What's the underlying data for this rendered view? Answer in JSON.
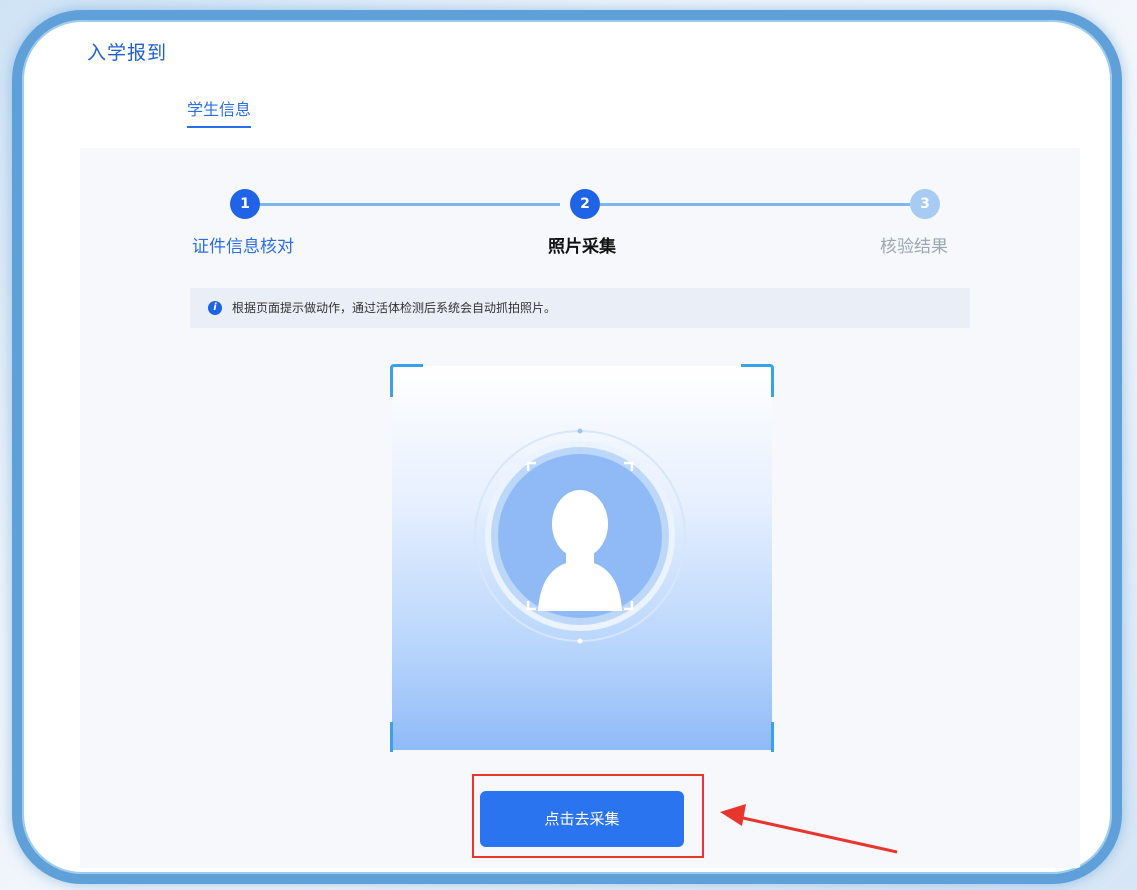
{
  "app": {
    "title": "入学报到"
  },
  "tabs": [
    {
      "label": "学生信息",
      "active": true
    }
  ],
  "steps": [
    {
      "number": "1",
      "label": "证件信息核对",
      "status": "done"
    },
    {
      "number": "2",
      "label": "照片采集",
      "status": "current"
    },
    {
      "number": "3",
      "label": "核验结果",
      "status": "pending"
    }
  ],
  "notice": {
    "text": "根据页面提示做动作，通过活体检测后系统会自动抓拍照片。"
  },
  "capture": {
    "button_label": "点击去采集"
  },
  "colors": {
    "primary": "#2b74f0",
    "step_pending": "#a7cbf2",
    "highlight": "#e8362e",
    "frame": "#5fa0d9"
  }
}
